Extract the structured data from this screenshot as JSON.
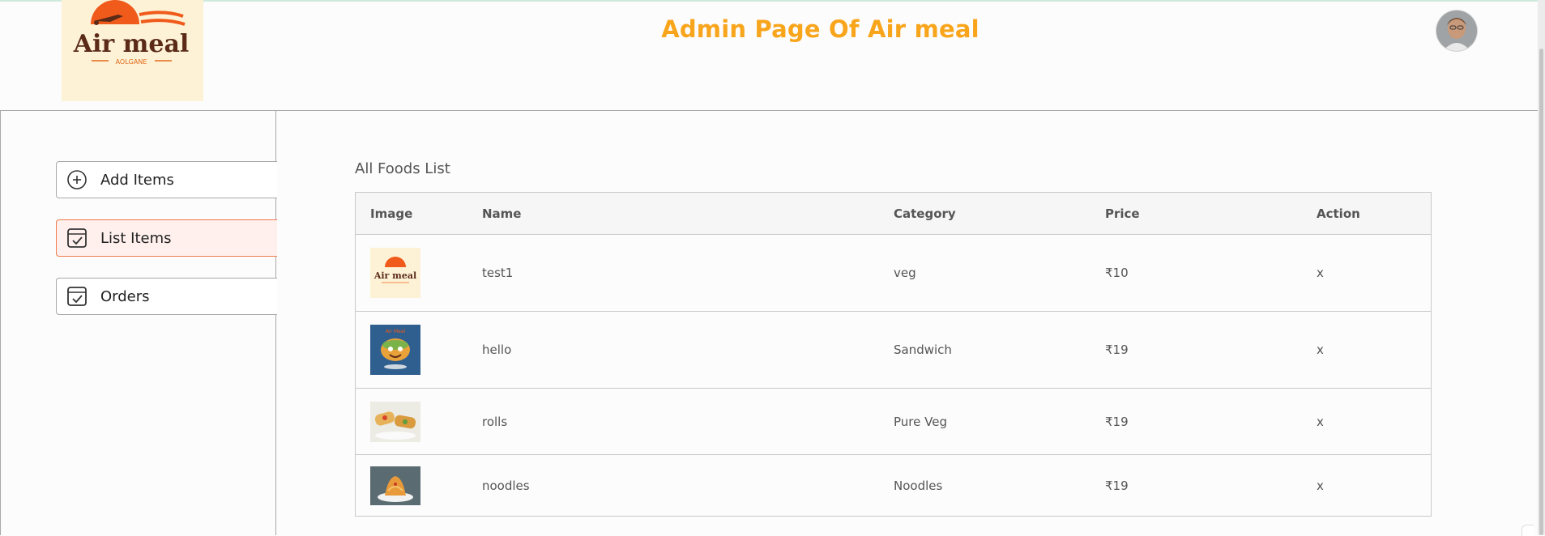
{
  "header": {
    "title": "Admin Page Of Air meal",
    "logo": {
      "main": "Air meal",
      "sub": "AOLGANE"
    },
    "accent_color": "#f8a51c"
  },
  "sidebar": {
    "items": [
      {
        "label": "Add Items",
        "icon": "add-circle-icon"
      },
      {
        "label": "List Items",
        "icon": "checkbox-icon",
        "active": true
      },
      {
        "label": "Orders",
        "icon": "checkbox-icon"
      }
    ],
    "active_color": "#f07a4a"
  },
  "list": {
    "title": "All Foods List",
    "columns": [
      "Image",
      "Name",
      "Category",
      "Price",
      "Action"
    ],
    "rows": [
      {
        "name": "test1",
        "category": "veg",
        "price": "₹10",
        "action": "x",
        "image": "air-meal-logo"
      },
      {
        "name": "hello",
        "category": "Sandwich",
        "price": "₹19",
        "action": "x",
        "image": "sandwich-mascot"
      },
      {
        "name": "rolls",
        "category": "Pure Veg",
        "price": "₹19",
        "action": "x",
        "image": "rolls-photo"
      },
      {
        "name": "noodles",
        "category": "Noodles",
        "price": "₹19",
        "action": "x",
        "image": "noodles-photo"
      }
    ]
  }
}
